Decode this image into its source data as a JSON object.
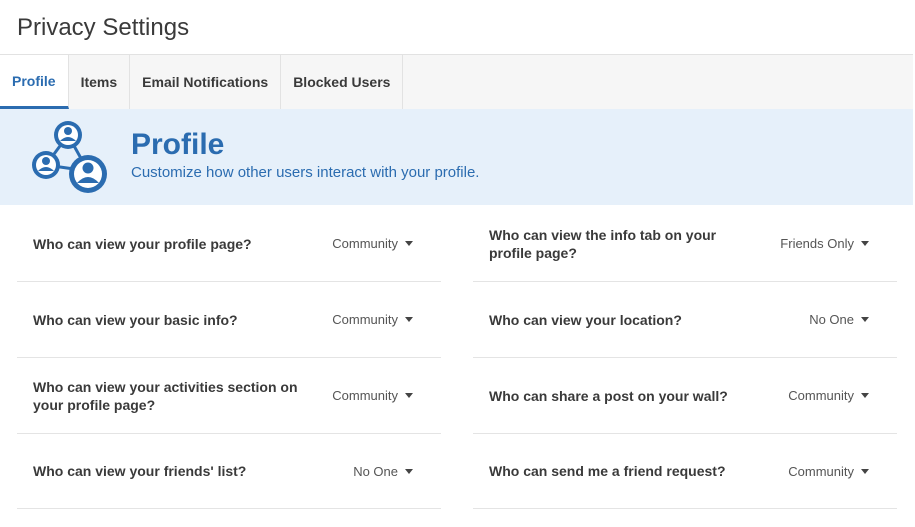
{
  "page": {
    "title": "Privacy Settings"
  },
  "tabs": [
    {
      "label": "Profile",
      "active": true
    },
    {
      "label": "Items",
      "active": false
    },
    {
      "label": "Email Notifications",
      "active": false
    },
    {
      "label": "Blocked Users",
      "active": false
    }
  ],
  "hero": {
    "icon": "users-network-icon",
    "title": "Profile",
    "subtitle": "Customize how other users interact with your profile."
  },
  "settings": {
    "left": [
      {
        "question": "Who can view your profile page?",
        "value": "Community"
      },
      {
        "question": "Who can view your basic info?",
        "value": "Community"
      },
      {
        "question": "Who can view your activities section on your profile page?",
        "value": "Community"
      },
      {
        "question": "Who can view your friends' list?",
        "value": "No One"
      }
    ],
    "right": [
      {
        "question": "Who can view the info tab on your profile page?",
        "value": "Friends Only"
      },
      {
        "question": "Who can view your location?",
        "value": "No One"
      },
      {
        "question": "Who can share a post on your wall?",
        "value": "Community"
      },
      {
        "question": "Who can send me a friend request?",
        "value": "Community"
      }
    ]
  },
  "colors": {
    "accent": "#2b6cb0",
    "hero_bg": "#e6f0fa"
  }
}
